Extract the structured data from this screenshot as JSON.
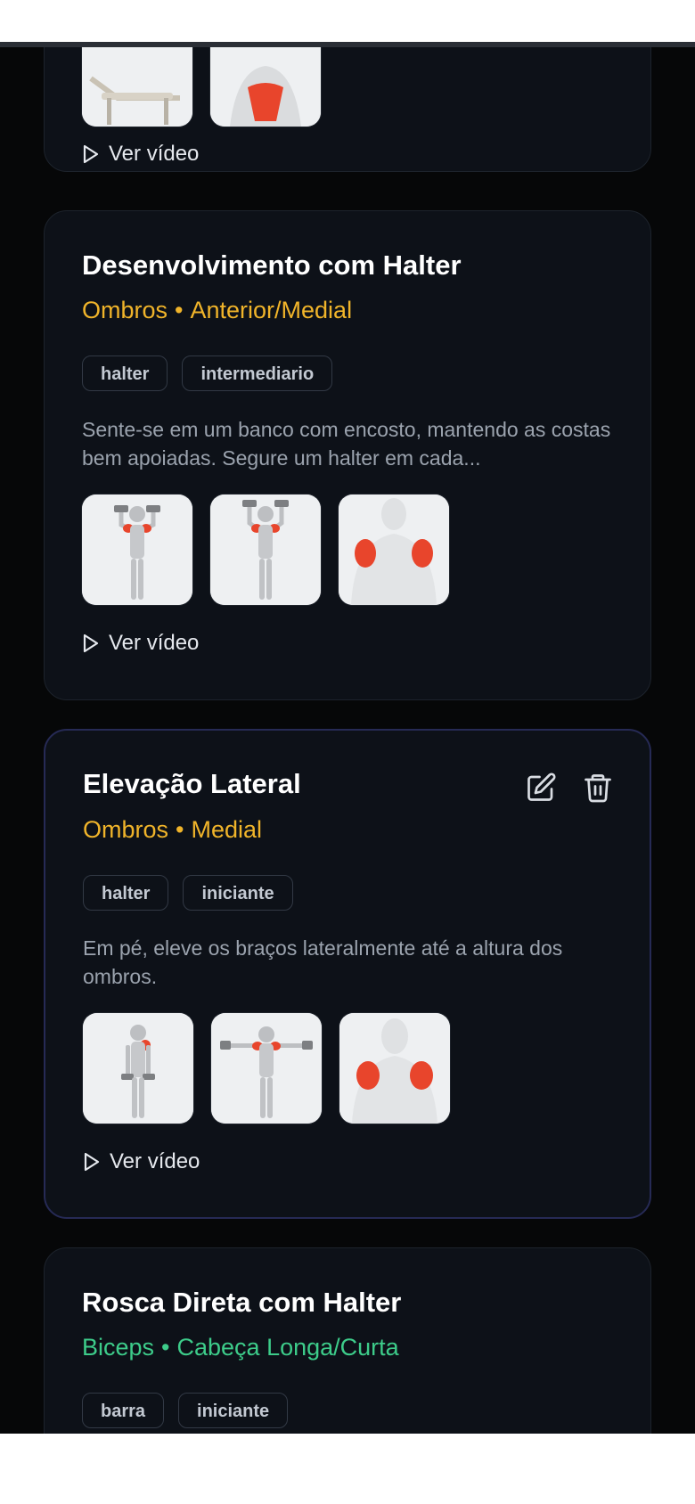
{
  "cards": [
    {
      "id": "partial",
      "video_label": "Ver vídeo"
    },
    {
      "id": "desenvolvimento",
      "title": "Desenvolvimento com Halter",
      "muscle": "Ombros",
      "separator": "•",
      "region": "Anterior/Medial",
      "accent": "#f0b42a",
      "tags": [
        "halter",
        "intermediario"
      ],
      "description": "Sente-se em um banco com encosto, mantendo as costas bem apoiadas. Segure um halter em cada...",
      "video_label": "Ver vídeo"
    },
    {
      "id": "elevacao",
      "title": "Elevação Lateral",
      "muscle": "Ombros",
      "separator": "•",
      "region": "Medial",
      "accent": "#f0b42a",
      "tags": [
        "halter",
        "iniciante"
      ],
      "description": "Em pé, eleve os braços lateralmente até a altura dos ombros.",
      "video_label": "Ver vídeo",
      "actions": {
        "edit_icon": "edit-icon",
        "delete_icon": "trash-icon"
      }
    },
    {
      "id": "rosca",
      "title": "Rosca Direta com Halter",
      "muscle": "Biceps",
      "separator": "•",
      "region": "Cabeça Longa/Curta",
      "accent": "#3dcc8a",
      "tags": [
        "barra",
        "iniciante"
      ]
    }
  ],
  "colors": {
    "background": "#060708",
    "card": "#0d1118",
    "shoulder_accent": "#f0b42a",
    "biceps_accent": "#3dcc8a",
    "muscle_highlight": "#e8452c"
  }
}
